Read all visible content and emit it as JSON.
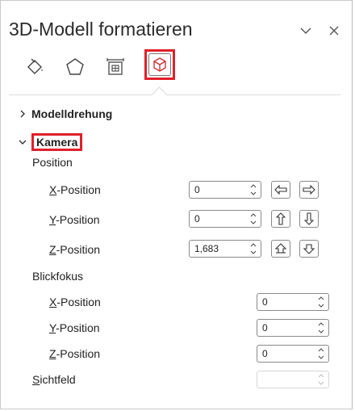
{
  "panel": {
    "title": "3D-Modell formatieren",
    "collapse_icon": "chevron-down-icon",
    "close_icon": "close-icon"
  },
  "tabs": [
    {
      "name": "fill-line",
      "icon": "paint-bucket-icon",
      "active": false
    },
    {
      "name": "effects",
      "icon": "pentagon-icon",
      "active": false
    },
    {
      "name": "size-properties",
      "icon": "size-position-icon",
      "active": false
    },
    {
      "name": "3d-model",
      "icon": "3d-cube-icon",
      "active": true
    }
  ],
  "sections": {
    "modelldrehung": {
      "label": "Modelldrehung",
      "expanded": false
    },
    "kamera": {
      "label": "Kamera",
      "expanded": true
    }
  },
  "camera": {
    "position_label": "Position",
    "x_label_ul": "X",
    "x_label_rest": "-Position",
    "x_value": "0",
    "y_label_ul": "Y",
    "y_label_rest": "-Position",
    "y_value": "0",
    "z_label_ul": "Z",
    "z_label_rest": "-Position",
    "z_value": "1,683",
    "focus_label": "Blickfokus",
    "fx_label_ul": "X",
    "fx_label_rest": "-Position",
    "fx_value": "0",
    "fy_label_ul": "Y",
    "fy_label_rest": "-Position",
    "fy_value": "0",
    "fz_label_ul": "Z",
    "fz_label_rest": "-Position",
    "fz_value": "0",
    "fov_label_ul": "S",
    "fov_label_rest": "ichtfeld",
    "fov_value": ""
  },
  "colors": {
    "highlight": "#e0202a"
  }
}
